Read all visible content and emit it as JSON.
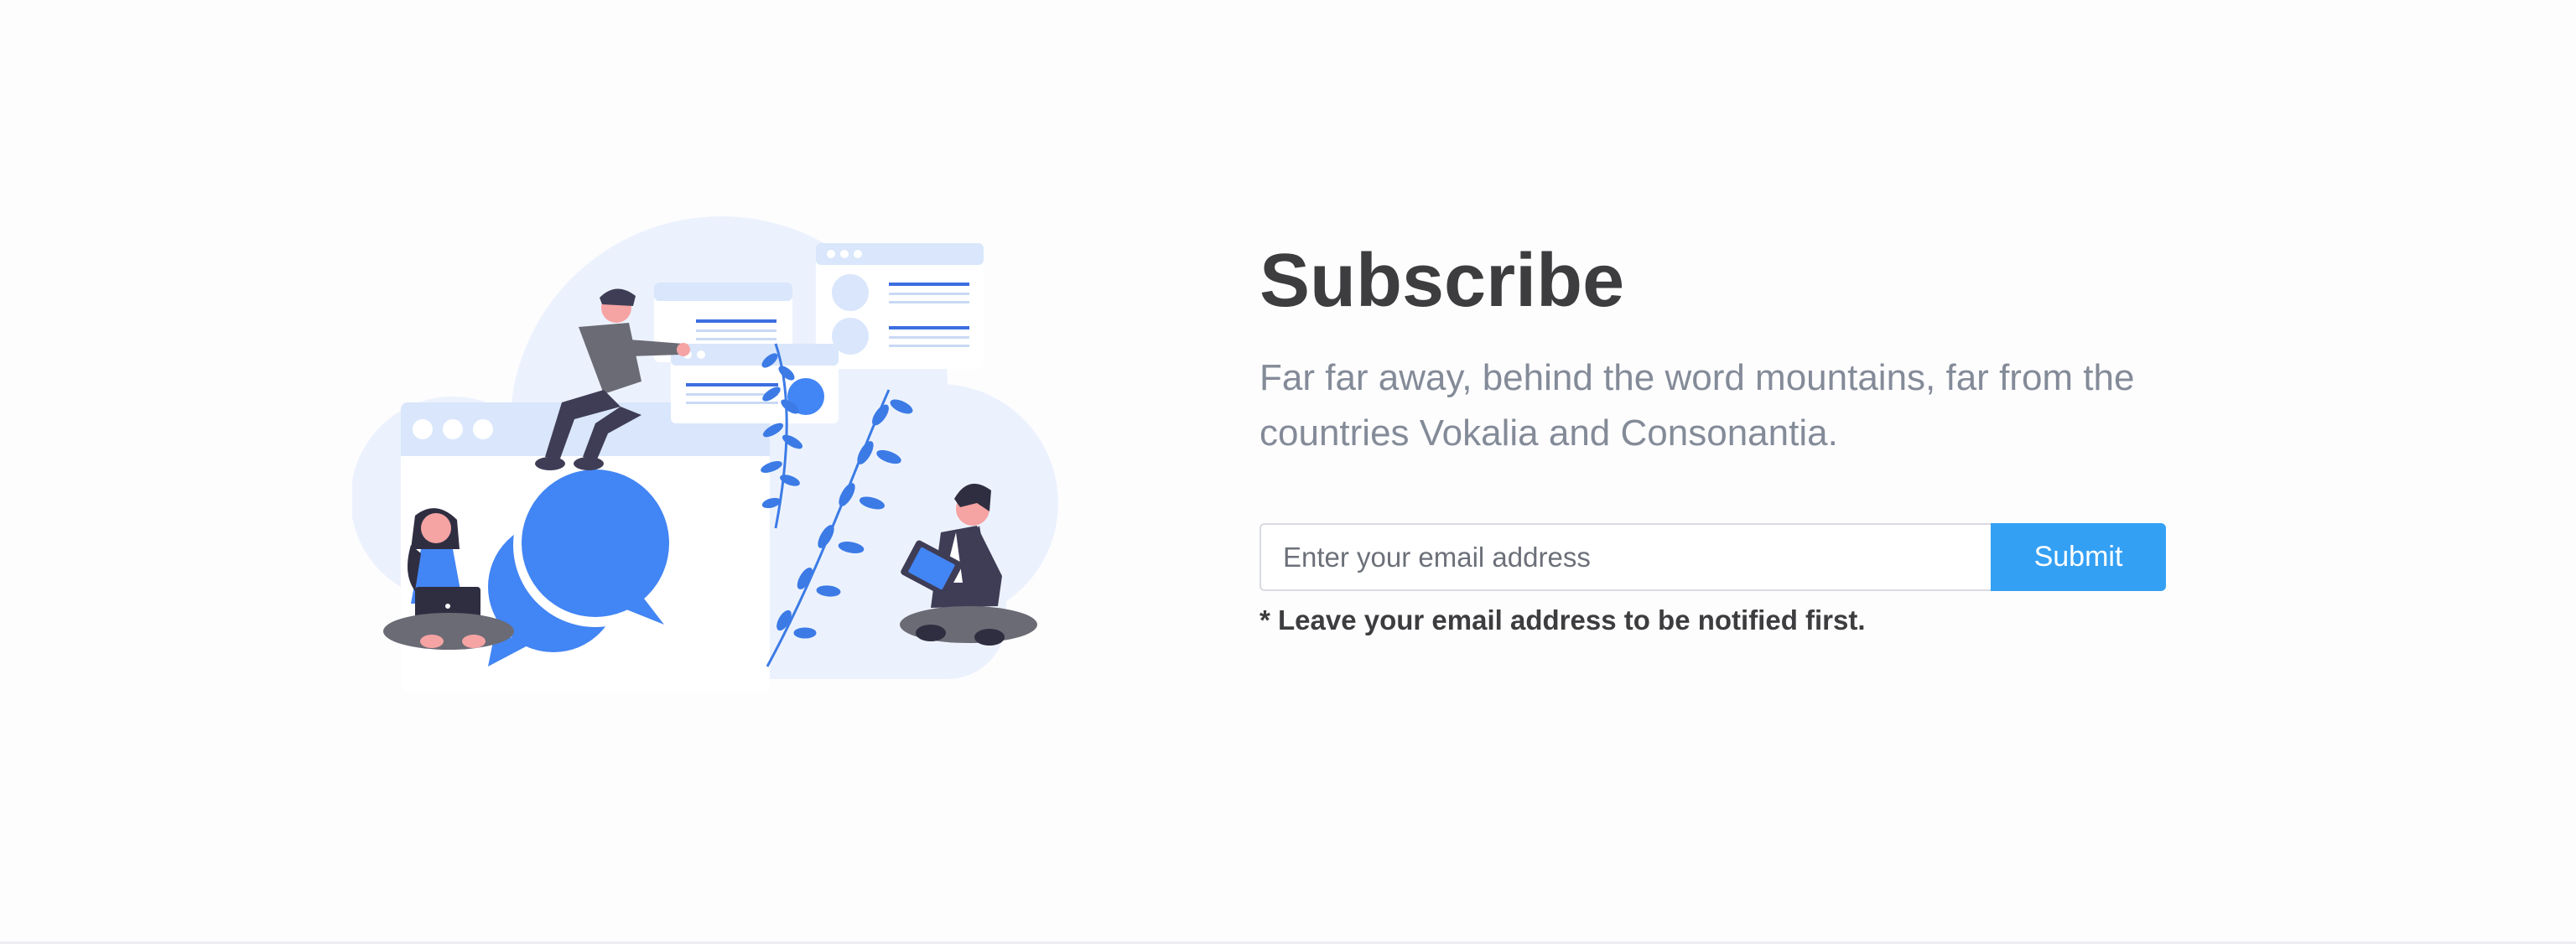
{
  "subscribe": {
    "title": "Subscribe",
    "description": "Far far away, behind the word mountains, far from the countries Vokalia and Consonantia.",
    "email_placeholder": "Enter your email address",
    "submit_label": "Submit",
    "note": "* Leave your email address to be notified first."
  },
  "illustration": {
    "icon": "people-chatting-illustration"
  },
  "colors": {
    "accent": "#34a0f4",
    "illustration_blue": "#4285f4",
    "cloud": "#ecf2fd",
    "title_text": "#3d3d3f",
    "muted_text": "#848b98"
  }
}
